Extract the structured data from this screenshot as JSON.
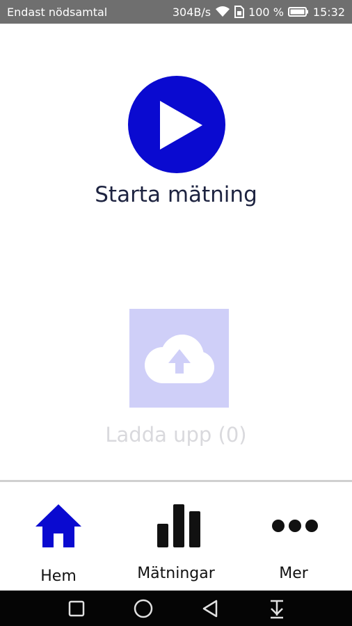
{
  "status_bar": {
    "carrier": "Endast nödsamtal",
    "network_speed": "304B/s",
    "battery_percent": "100 %",
    "time": "15:32",
    "icons": [
      "wifi-icon",
      "sim-icon",
      "battery-icon"
    ]
  },
  "main": {
    "start_label": "Starta mätning",
    "start_icon": "play-icon",
    "upload_label": "Ladda upp (0)",
    "upload_icon": "cloud-upload-icon",
    "upload_enabled": false
  },
  "bottom_nav": {
    "items": [
      {
        "label": "Hem",
        "icon": "home-icon",
        "active": true
      },
      {
        "label": "Mätningar",
        "icon": "bar-chart-icon",
        "active": false
      },
      {
        "label": "Mer",
        "icon": "more-icon",
        "active": false
      }
    ]
  },
  "system_nav": {
    "buttons": [
      "recents-icon",
      "home-circle-icon",
      "back-icon",
      "notifications-pull-icon"
    ]
  },
  "colors": {
    "accent": "#0a0ad0",
    "upload_disabled_bg": "#cfcff8",
    "status_bar_bg": "#6f6f6f",
    "nav_active": "#0a0ad0",
    "nav_inactive": "#111111"
  }
}
